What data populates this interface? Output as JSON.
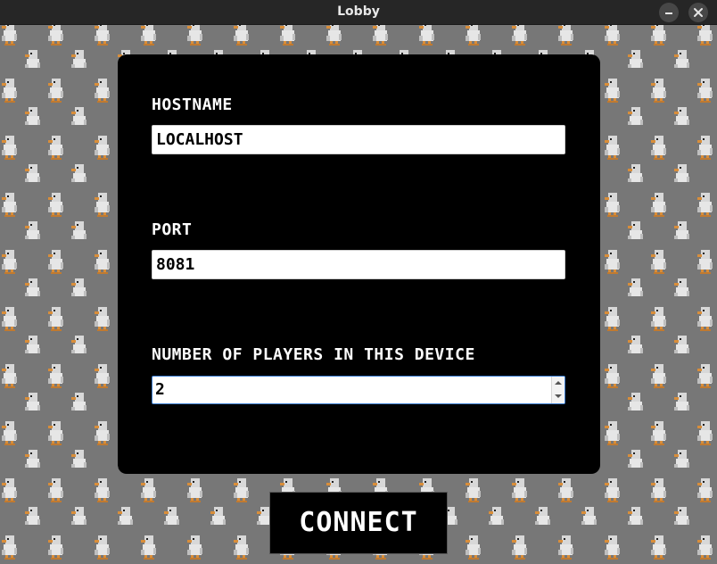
{
  "window": {
    "title": "Lobby",
    "minimize_icon": "minimize-icon",
    "close_icon": "close-icon"
  },
  "background": {
    "pattern": "tiled pixel-art white goose sprites",
    "color": "#777777"
  },
  "form": {
    "hostname": {
      "label": "HOSTNAME",
      "value": "LOCALHOST"
    },
    "port": {
      "label": "PORT",
      "value": "8081"
    },
    "players": {
      "label": "NUMBER OF PLAYERS IN THIS DEVICE",
      "value": "2"
    }
  },
  "connect_button": {
    "label": "CONNECT"
  },
  "colors": {
    "titlebar": "#262626",
    "panel": "#000000",
    "field_bg": "#ffffff",
    "focus_border": "#3d7ed1",
    "text_light": "#ffffff"
  }
}
